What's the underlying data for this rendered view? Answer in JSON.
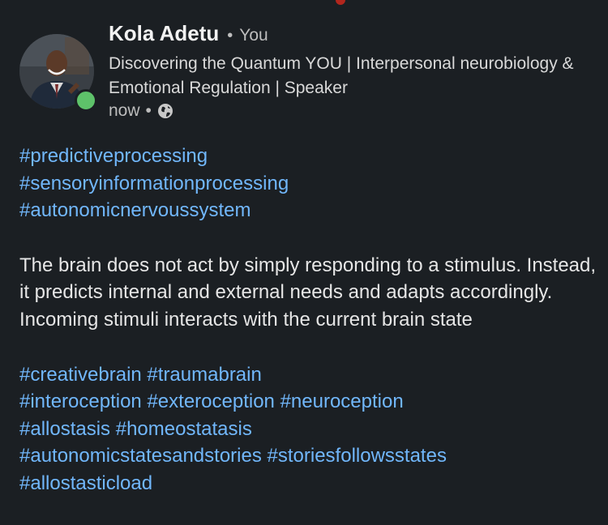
{
  "author": {
    "name": "Kola Adetu",
    "relation": "You",
    "headline": "Discovering the Quantum YOU | Interpersonal neurobiology & Emotional Regulation | Speaker",
    "time": "now",
    "visibility_icon": "globe-icon",
    "online_status": "online",
    "avatar": "profile-photo"
  },
  "post": {
    "hashtags_top": [
      "#predictiveprocessing",
      "#sensoryinformationprocessing",
      "#autonomicnervoussystem"
    ],
    "body": "The brain does not act by simply responding to a stimulus. Instead, it predicts internal and external needs and adapts accordingly. Incoming stimuli interacts with the current brain state",
    "hashtags_bottom": [
      [
        "#creativebrain",
        "#traumabrain"
      ],
      [
        "#interoception",
        "#exteroception",
        "#neuroception"
      ],
      [
        "#allostasis",
        "#homeostatasis"
      ],
      [
        "#autonomicstatesandstories",
        "#storiesfollowsstates"
      ],
      [
        "#allostasticload"
      ]
    ]
  },
  "colors": {
    "background": "#1b1f23",
    "hashtag": "#71b7fb",
    "online": "#5ec26a",
    "text": "#e6e6e6",
    "muted": "#bdbdbd"
  }
}
